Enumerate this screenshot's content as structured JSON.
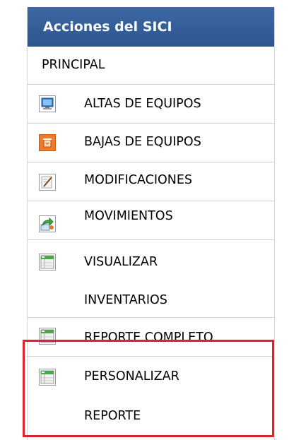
{
  "header": {
    "title": "Acciones del SICI"
  },
  "menu": {
    "principal": "PRINCIPAL",
    "altas": "ALTAS DE EQUIPOS",
    "bajas": "BAJAS DE EQUIPOS",
    "modificaciones": "MODIFICACIONES",
    "movimientos": "MOVIMIENTOS",
    "visualizar_line1": "VISUALIZAR",
    "visualizar_line2": "INVENTARIOS",
    "reporte_completo": "REPORTE COMPLETO",
    "personalizar_line1": "PERSONALIZAR",
    "personalizar_line2": "REPORTE"
  },
  "colors": {
    "header_bg": "#2e5690",
    "highlight_border": "#e0222e"
  },
  "icons": {
    "altas": "monitor-icon",
    "bajas": "trash-icon",
    "modificaciones": "edit-icon",
    "movimientos": "move-arrow-icon",
    "visualizar": "spreadsheet-icon",
    "reporte_completo": "spreadsheet-icon",
    "personalizar": "spreadsheet-icon"
  }
}
